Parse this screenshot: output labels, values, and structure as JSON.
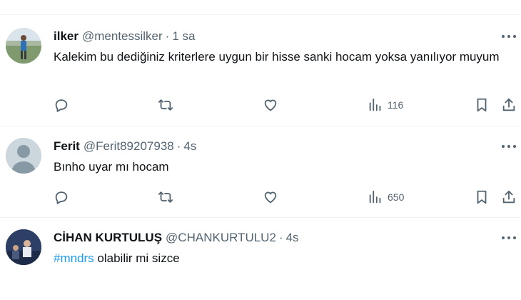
{
  "tweets": [
    {
      "name": "ilker",
      "handle": "@mentessilker",
      "separator": "·",
      "time": "1 sa",
      "text": "Kalekim bu dediğiniz kriterlere uygun bir hisse sanki hocam yoksa yanılıyor muyum",
      "views": "116"
    },
    {
      "name": "Ferit",
      "handle": "@Ferit89207938",
      "separator": "·",
      "time": "4s",
      "text": "Bınho uyar mı hocam",
      "views": "650"
    },
    {
      "name": "CİHAN KURTULUŞ",
      "handle": "@CHANKURTULU2",
      "separator": "·",
      "time": "4s",
      "hashtag": "#mndrs",
      "text_rest": " olabilir mi sizce"
    }
  ],
  "icons": {
    "reply": "reply-icon",
    "retweet": "retweet-icon",
    "like": "heart-icon",
    "views": "views-bar-chart-icon",
    "bookmark": "bookmark-icon",
    "share": "share-icon",
    "more": "more-dots-icon"
  },
  "colors": {
    "text": "#0f1419",
    "secondary": "#536471",
    "link": "#1d9bf0",
    "divider": "#eff3f4"
  }
}
